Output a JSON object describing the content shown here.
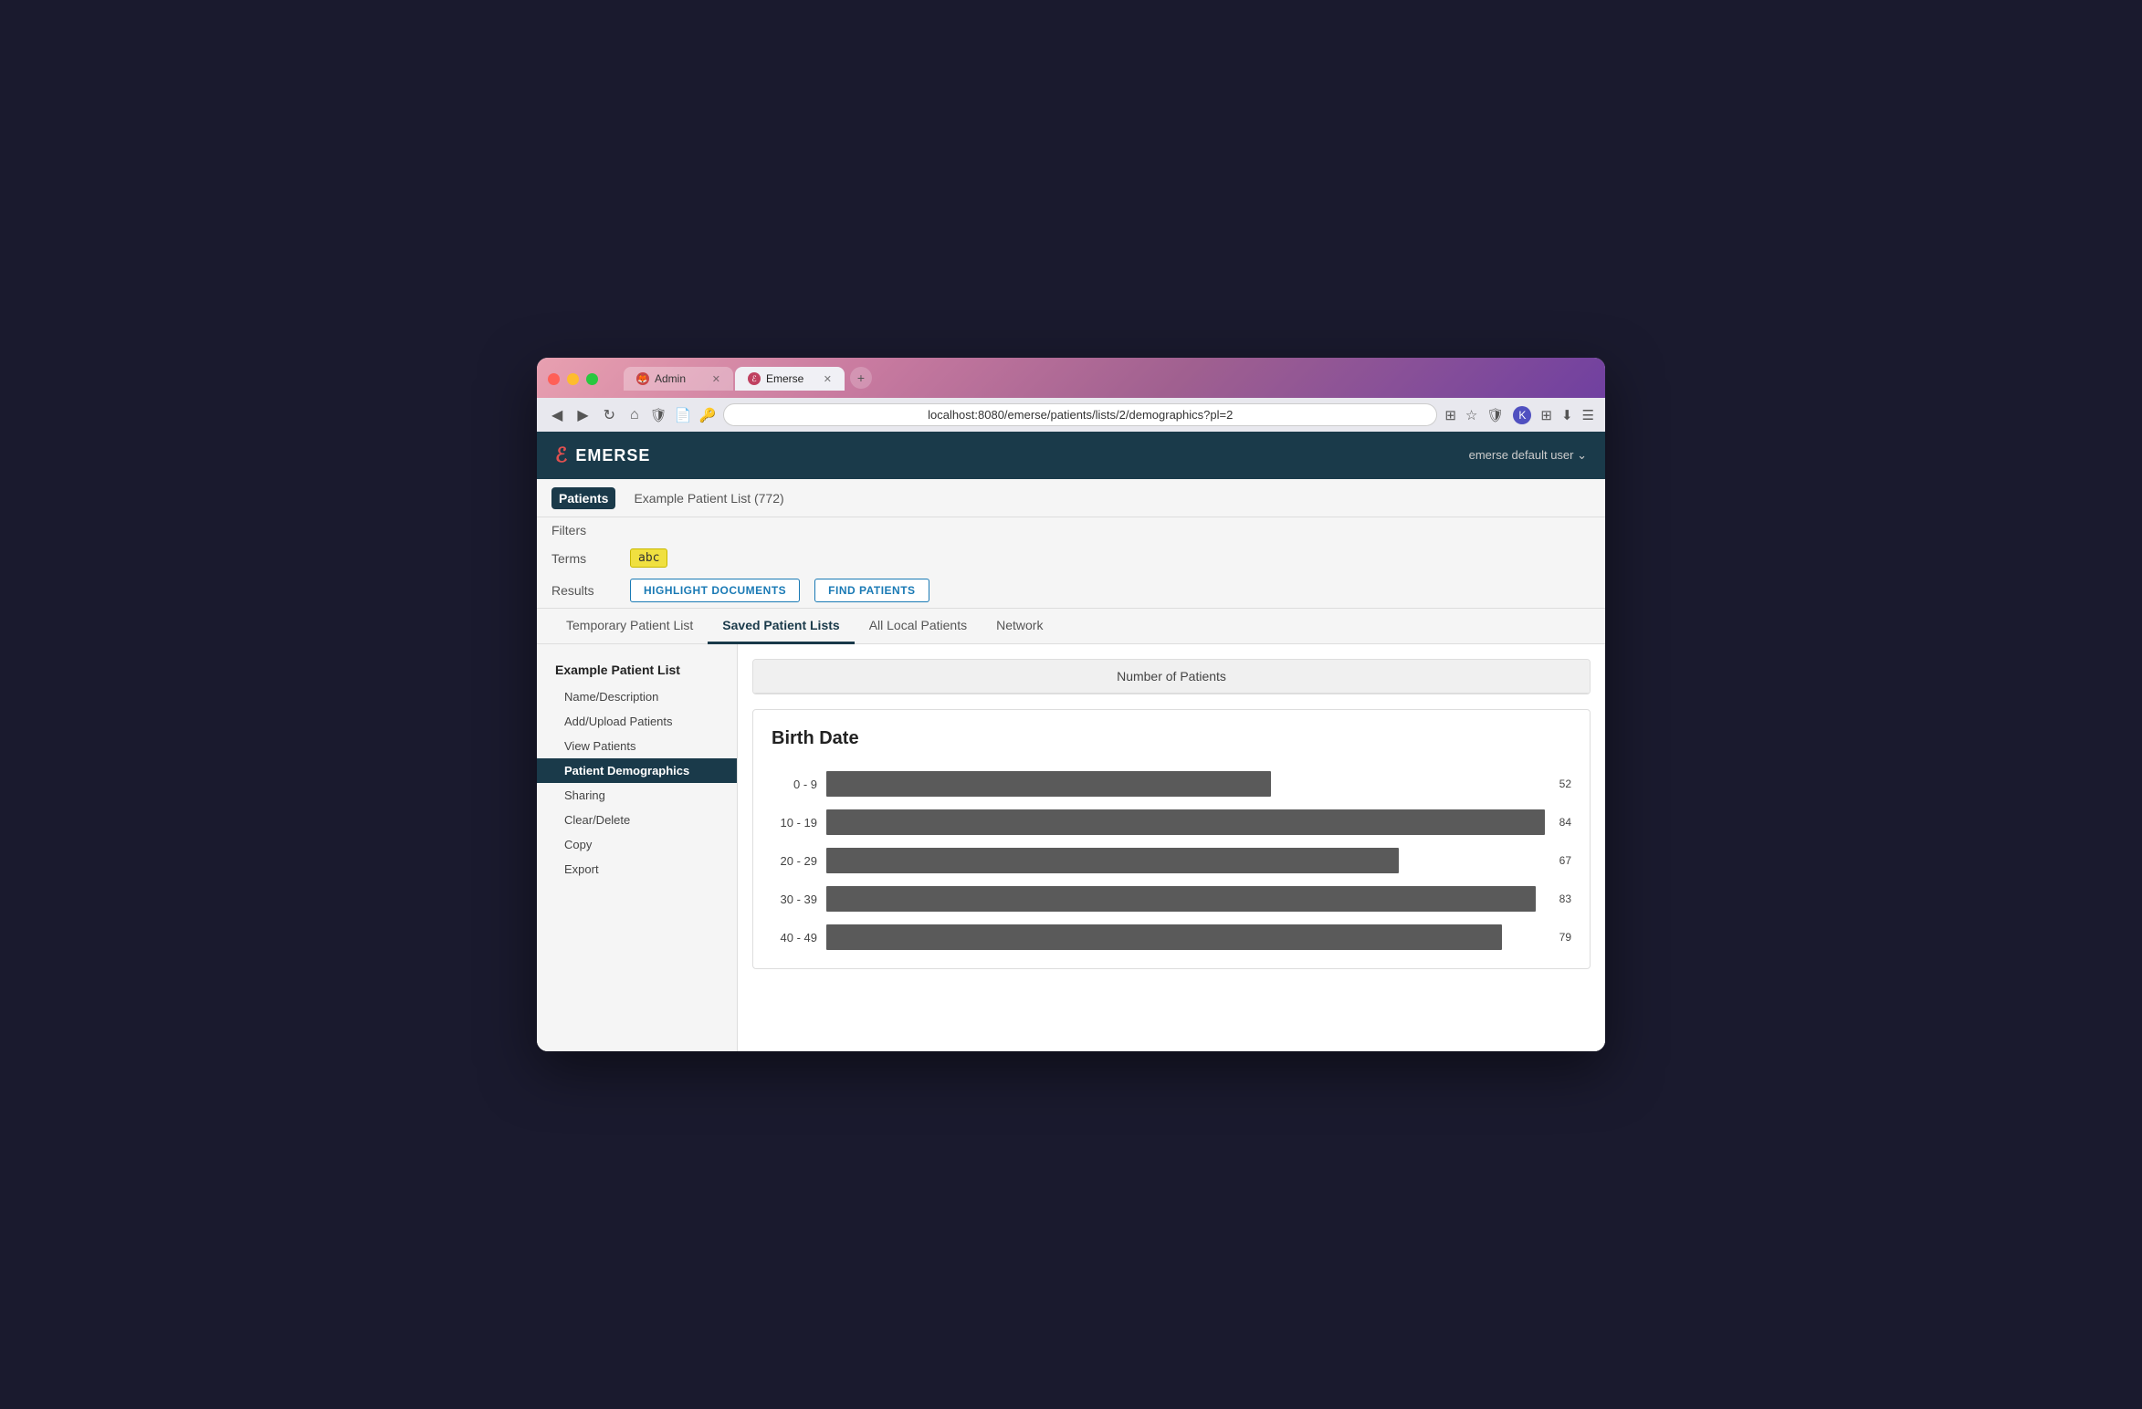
{
  "browser": {
    "tabs": [
      {
        "id": "admin",
        "label": "Admin",
        "active": false,
        "favicon": "🦊"
      },
      {
        "id": "emerse",
        "label": "Emerse",
        "active": true,
        "favicon": "E"
      }
    ],
    "address": "localhost:8080/emerse/patients/lists/2/demographics?pl=2",
    "new_tab_label": "+"
  },
  "app": {
    "logo": "EMERSE",
    "user": "emerse default user ⌄"
  },
  "subnav": {
    "active_item": "Patients",
    "items": [
      "Patients"
    ],
    "breadcrumb": "Example Patient List (772)"
  },
  "filters": {
    "label_filters": "Filters",
    "label_terms": "Terms",
    "label_results": "Results",
    "term_value": "abc",
    "btn_highlight": "HIGHLIGHT DOCUMENTS",
    "btn_find": "FIND PATIENTS"
  },
  "tabs": [
    {
      "id": "temporary",
      "label": "Temporary Patient List",
      "active": false
    },
    {
      "id": "saved",
      "label": "Saved Patient Lists",
      "active": true
    },
    {
      "id": "local",
      "label": "All Local Patients",
      "active": false
    },
    {
      "id": "network",
      "label": "Network",
      "active": false
    }
  ],
  "sidebar": {
    "group_title": "Example Patient List",
    "items": [
      {
        "id": "name",
        "label": "Name/Description",
        "active": false
      },
      {
        "id": "add",
        "label": "Add/Upload Patients",
        "active": false
      },
      {
        "id": "view",
        "label": "View Patients",
        "active": false
      },
      {
        "id": "demographics",
        "label": "Patient Demographics",
        "active": true
      },
      {
        "id": "sharing",
        "label": "Sharing",
        "active": false
      },
      {
        "id": "clear",
        "label": "Clear/Delete",
        "active": false
      },
      {
        "id": "copy",
        "label": "Copy",
        "active": false
      },
      {
        "id": "export",
        "label": "Export",
        "active": false
      }
    ]
  },
  "charts": {
    "patients_card_label": "Number of Patients",
    "birth_date": {
      "title": "Birth Date",
      "max_value": 84,
      "bars": [
        {
          "label": "0 - 9",
          "value": 52
        },
        {
          "label": "10 - 19",
          "value": 84
        },
        {
          "label": "20 - 29",
          "value": 67
        },
        {
          "label": "30 - 39",
          "value": 83
        },
        {
          "label": "40 - 49",
          "value": 79
        }
      ]
    }
  }
}
